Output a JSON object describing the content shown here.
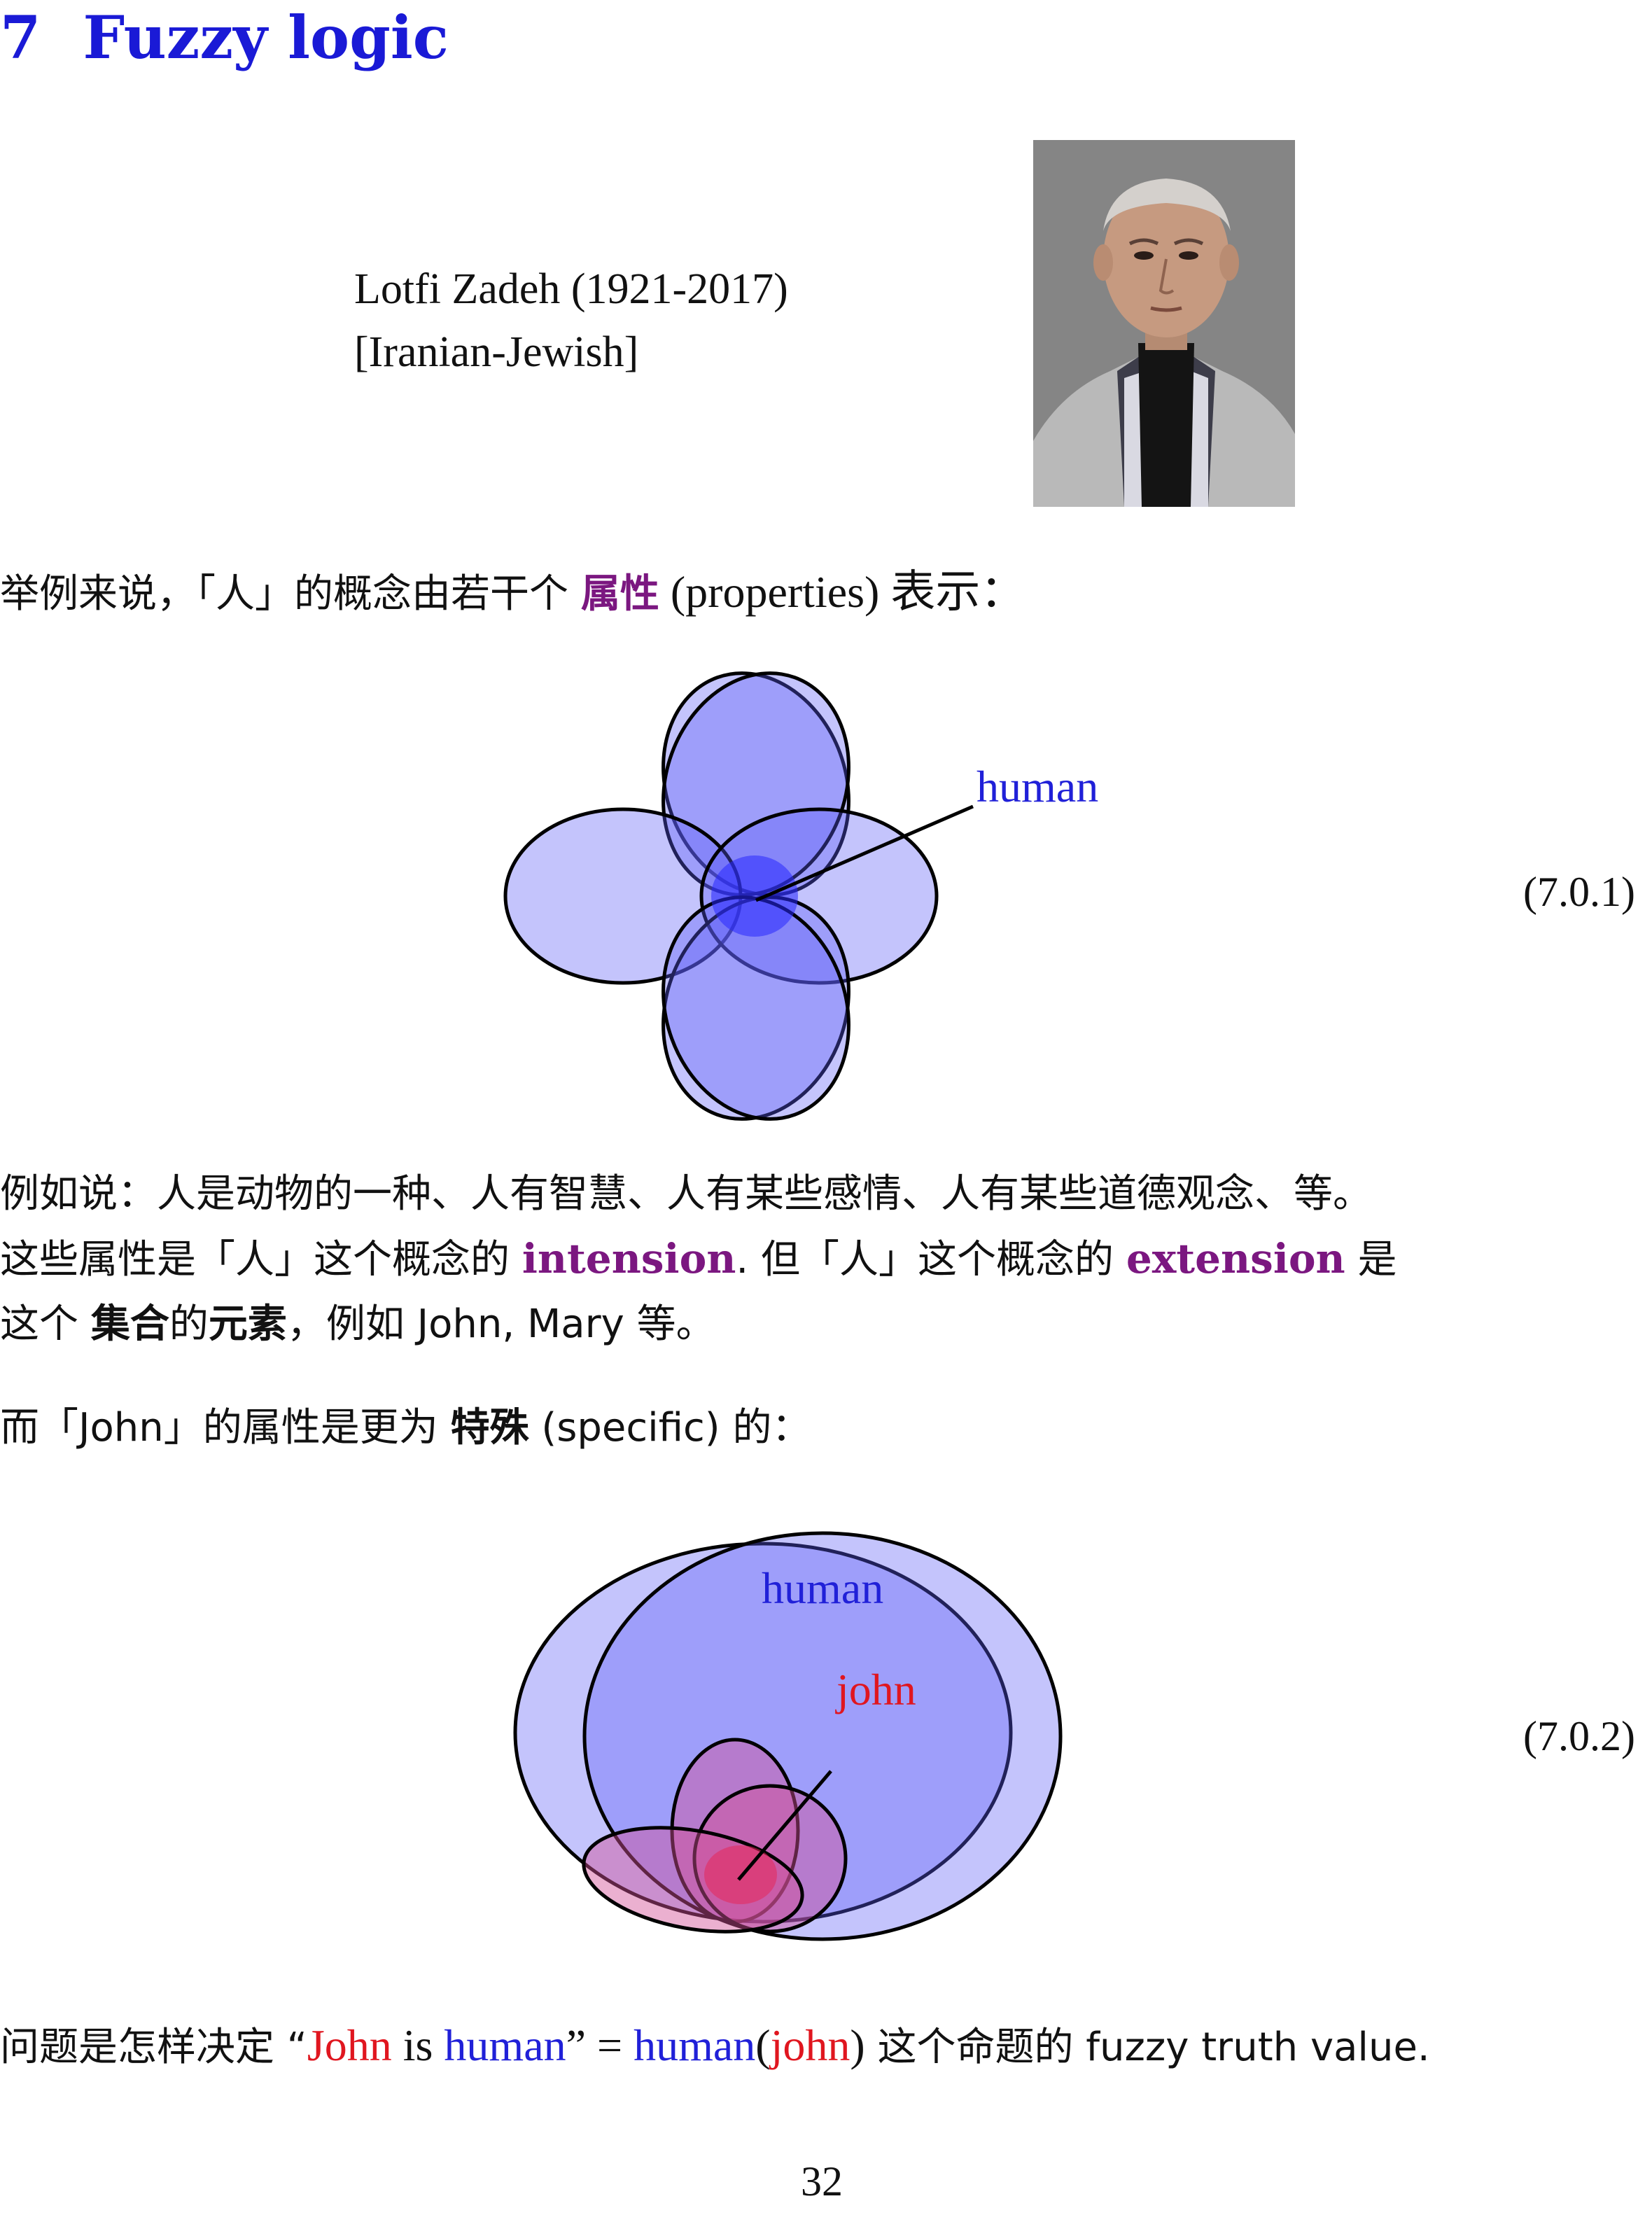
{
  "section": {
    "number": "7",
    "title": "Fuzzy logic"
  },
  "portrait": {
    "name_line": "Lotfi Zadeh (1921-2017)",
    "origin_line": "[Iranian-Jewish]"
  },
  "para1": {
    "text_a": "举例来说，「人」的概念由若干个 ",
    "term": "属性",
    "text_b": " (properties) 表示："
  },
  "figure1": {
    "label": "human",
    "eq_number": "(7.0.1)"
  },
  "para2": {
    "line1": "例如说：人是动物的一种、人有智慧、人有某些感情、人有某些道德观念、等。",
    "line2_a": "这些属性是「人」这个概念的 ",
    "line2_term1": "intension",
    "line2_b": ". 但「人」这个概念的 ",
    "line2_term2": "extension",
    "line2_c": " 是",
    "line3_a": "这个 ",
    "line3_term1": "集合",
    "line3_b": "的",
    "line3_term2": "元素",
    "line3_c": "，例如 John, Mary 等。"
  },
  "para3": {
    "text_a": "而「John」的属性是更为 ",
    "term": "特殊",
    "text_b": " (specific) 的："
  },
  "figure2": {
    "label_outer": "human",
    "label_inner": "john",
    "eq_number": "(7.0.2)"
  },
  "para4": {
    "text_a": "问题是怎样决定 “",
    "john": "John",
    "is": " is ",
    "human": "human",
    "close": "” = ",
    "human2": "human",
    "paren_open": "(",
    "john2": "john",
    "paren_close": ")",
    "text_b": " 这个命题的 fuzzy truth value."
  },
  "page_number": "32",
  "colors": {
    "heading_blue": "#1a1ad6",
    "term_purple": "#7b1780",
    "john_red": "#e0161f",
    "human_blue": "#2020d8"
  }
}
